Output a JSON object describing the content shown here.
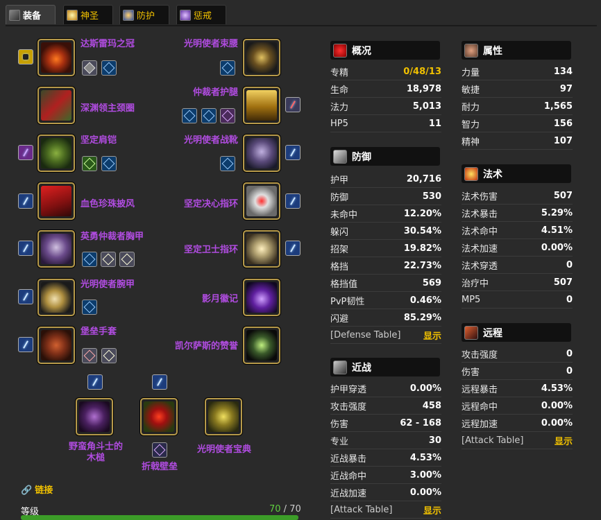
{
  "tabs": [
    {
      "label": "装备",
      "icon": "armor-icon",
      "color": "#6a6a6a"
    },
    {
      "label": "神圣",
      "icon": "holy-icon",
      "color": "#c8a020"
    },
    {
      "label": "防护",
      "icon": "protection-icon",
      "color": "#3a5ab0"
    },
    {
      "label": "惩戒",
      "icon": "retribution-icon",
      "color": "#8a4ab0"
    }
  ],
  "equipment": {
    "left": [
      {
        "name": "达斯雷玛之冠",
        "gems": 2,
        "enchant": true
      },
      {
        "name": "深渊领主颈圈",
        "gems": 0,
        "enchant": false
      },
      {
        "name": "坚定肩铠",
        "gems": 2,
        "enchant": true
      },
      {
        "name": "血色珍珠披风",
        "gems": 0,
        "enchant": true
      },
      {
        "name": "英勇仲裁者胸甲",
        "gems": 3,
        "enchant": true
      },
      {
        "name": "光明使者腕甲",
        "gems": 1,
        "enchant": true
      },
      {
        "name": "堡垒手套",
        "gems": 2,
        "enchant": true
      }
    ],
    "right": [
      {
        "name": "光明使者束腰",
        "gems": 1,
        "enchant": false
      },
      {
        "name": "仲裁者护腿",
        "gems": 3,
        "enchant": true
      },
      {
        "name": "光明使者战靴",
        "gems": 1,
        "enchant": true
      },
      {
        "name": "坚定决心指环",
        "gems": 0,
        "enchant": true
      },
      {
        "name": "坚定卫士指环",
        "gems": 0,
        "enchant": true
      },
      {
        "name": "影月徽记",
        "gems": 0,
        "enchant": false
      },
      {
        "name": "凯尔萨斯的赞誉",
        "gems": 0,
        "enchant": false
      }
    ],
    "weapons": [
      {
        "name": "野蛮角斗士的木槌",
        "line2": "木槌",
        "line1": "野蛮角斗士的"
      },
      {
        "name": "折戟壁垒"
      },
      {
        "name": "光明使者宝典"
      }
    ]
  },
  "overview": {
    "title": "概况",
    "rows": [
      {
        "k": "专精",
        "v": "0/48/13",
        "gold": true
      },
      {
        "k": "生命",
        "v": "18,978"
      },
      {
        "k": "法力",
        "v": "5,013"
      },
      {
        "k": "HP5",
        "v": "11"
      }
    ]
  },
  "attributes": {
    "title": "属性",
    "rows": [
      {
        "k": "力量",
        "v": "134"
      },
      {
        "k": "敏捷",
        "v": "97"
      },
      {
        "k": "耐力",
        "v": "1,565"
      },
      {
        "k": "智力",
        "v": "156"
      },
      {
        "k": "精神",
        "v": "107"
      }
    ]
  },
  "defense": {
    "title": "防御",
    "rows": [
      {
        "k": "护甲",
        "v": "20,716"
      },
      {
        "k": "防御",
        "v": "530"
      },
      {
        "k": "未命中",
        "v": "12.20%"
      },
      {
        "k": "躲闪",
        "v": "30.54%"
      },
      {
        "k": "招架",
        "v": "19.82%"
      },
      {
        "k": "格挡",
        "v": "22.73%"
      },
      {
        "k": "格挡值",
        "v": "569"
      },
      {
        "k": "PvP韧性",
        "v": "0.46%"
      },
      {
        "k": "闪避",
        "v": "85.29%"
      }
    ],
    "table_label": "[Defense Table]",
    "show": "显示"
  },
  "spell": {
    "title": "法术",
    "rows": [
      {
        "k": "法术伤害",
        "v": "507"
      },
      {
        "k": "法术暴击",
        "v": "5.29%"
      },
      {
        "k": "法术命中",
        "v": "4.51%"
      },
      {
        "k": "法术加速",
        "v": "0.00%"
      },
      {
        "k": "法术穿透",
        "v": "0"
      },
      {
        "k": "治疗中",
        "v": "507"
      },
      {
        "k": "MP5",
        "v": "0"
      }
    ]
  },
  "melee": {
    "title": "近战",
    "rows": [
      {
        "k": "护甲穿透",
        "v": "0.00%"
      },
      {
        "k": "攻击强度",
        "v": "458"
      },
      {
        "k": "伤害",
        "v": "62 - 168"
      },
      {
        "k": "专业",
        "v": "30"
      },
      {
        "k": "近战暴击",
        "v": "4.53%"
      },
      {
        "k": "近战命中",
        "v": "3.00%"
      },
      {
        "k": "近战加速",
        "v": "0.00%"
      }
    ],
    "table_label": "[Attack Table]",
    "show": "显示"
  },
  "ranged": {
    "title": "远程",
    "rows": [
      {
        "k": "攻击强度",
        "v": "0"
      },
      {
        "k": "伤害",
        "v": "0"
      },
      {
        "k": "远程暴击",
        "v": "4.53%"
      },
      {
        "k": "远程命中",
        "v": "0.00%"
      },
      {
        "k": "远程加速",
        "v": "0.00%"
      }
    ],
    "table_label": "[Attack Table]",
    "show": "显示"
  },
  "footer": {
    "link_label": "链接",
    "level_label": "等级",
    "level_current": "70",
    "level_sep": " / ",
    "level_max": "70",
    "level_fraction": 1.0
  }
}
